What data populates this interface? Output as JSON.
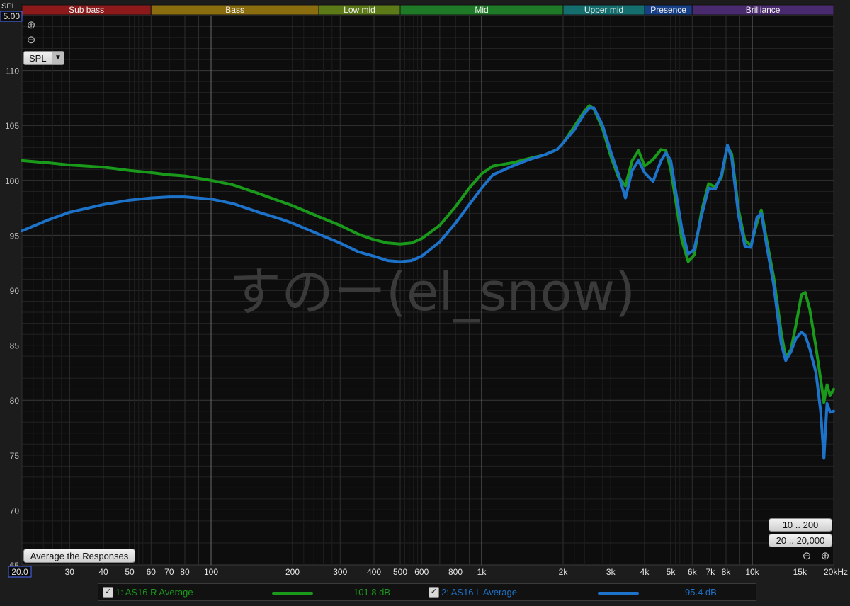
{
  "colors": {
    "series1": "#1a9a1a",
    "series2": "#1d72c9",
    "background": "#0d0d0d"
  },
  "bands": [
    {
      "label": "Sub bass",
      "from": 20,
      "to": 60,
      "color": "#8c1a1a"
    },
    {
      "label": "Bass",
      "from": 60,
      "to": 250,
      "color": "#8a6d0e"
    },
    {
      "label": "Low mid",
      "from": 250,
      "to": 500,
      "color": "#5d7a18"
    },
    {
      "label": "Mid",
      "from": 500,
      "to": 2000,
      "color": "#1e7a26"
    },
    {
      "label": "Upper mid",
      "from": 2000,
      "to": 4000,
      "color": "#156e6e"
    },
    {
      "label": "Presence",
      "from": 4000,
      "to": 6000,
      "color": "#173f85"
    },
    {
      "label": "Brilliance",
      "from": 6000,
      "to": 20000,
      "color": "#4a2a6e"
    }
  ],
  "controls": {
    "y_axis_label": "SPL",
    "y_top_value": "5.00",
    "x_left_value": "20.0",
    "spl_select": "SPL",
    "average_button": "Average the Responses",
    "range_button_1": "10 .. 200",
    "range_button_2": "20 .. 20,000",
    "zoom_in_icon": "⊕",
    "zoom_out_icon": "⊖"
  },
  "watermark": "すのー(el_snow)",
  "legend": {
    "items": [
      {
        "label": "1: AS16 R Average",
        "value": "101.8 dB",
        "color": "#1a9a1a"
      },
      {
        "label": "2: AS16 L Average",
        "value": "95.4 dB",
        "color": "#1d72c9"
      }
    ]
  },
  "chart_data": {
    "type": "line",
    "xlabel": "",
    "ylabel": "SPL",
    "x_scale": "log",
    "xlim": [
      20,
      20000
    ],
    "ylim": [
      65,
      115
    ],
    "grid": true,
    "y_ticks": [
      65,
      70,
      75,
      80,
      85,
      90,
      95,
      100,
      105,
      110
    ],
    "x_ticks": [
      {
        "v": 30,
        "label": "30"
      },
      {
        "v": 40,
        "label": "40"
      },
      {
        "v": 50,
        "label": "50"
      },
      {
        "v": 60,
        "label": "60"
      },
      {
        "v": 70,
        "label": "70"
      },
      {
        "v": 80,
        "label": "80"
      },
      {
        "v": 100,
        "label": "100"
      },
      {
        "v": 200,
        "label": "200"
      },
      {
        "v": 300,
        "label": "300"
      },
      {
        "v": 400,
        "label": "400"
      },
      {
        "v": 500,
        "label": "500"
      },
      {
        "v": 600,
        "label": "600"
      },
      {
        "v": 800,
        "label": "800"
      },
      {
        "v": 1000,
        "label": "1k"
      },
      {
        "v": 2000,
        "label": "2k"
      },
      {
        "v": 3000,
        "label": "3k"
      },
      {
        "v": 4000,
        "label": "4k"
      },
      {
        "v": 5000,
        "label": "5k"
      },
      {
        "v": 6000,
        "label": "6k"
      },
      {
        "v": 7000,
        "label": "7k"
      },
      {
        "v": 8000,
        "label": "8k"
      },
      {
        "v": 10000,
        "label": "10k"
      },
      {
        "v": 15000,
        "label": "15k"
      },
      {
        "v": 20000,
        "label": "20kHz"
      }
    ],
    "series": [
      {
        "name": "1: AS16 R Average",
        "points": [
          [
            20,
            101.8
          ],
          [
            25,
            101.6
          ],
          [
            30,
            101.4
          ],
          [
            40,
            101.2
          ],
          [
            50,
            100.9
          ],
          [
            60,
            100.7
          ],
          [
            70,
            100.5
          ],
          [
            80,
            100.4
          ],
          [
            100,
            100.0
          ],
          [
            120,
            99.6
          ],
          [
            150,
            98.8
          ],
          [
            180,
            98.1
          ],
          [
            200,
            97.7
          ],
          [
            250,
            96.7
          ],
          [
            300,
            95.9
          ],
          [
            350,
            95.1
          ],
          [
            400,
            94.6
          ],
          [
            450,
            94.3
          ],
          [
            500,
            94.2
          ],
          [
            550,
            94.3
          ],
          [
            600,
            94.7
          ],
          [
            700,
            95.9
          ],
          [
            800,
            97.6
          ],
          [
            900,
            99.3
          ],
          [
            1000,
            100.6
          ],
          [
            1100,
            101.3
          ],
          [
            1300,
            101.6
          ],
          [
            1500,
            102.0
          ],
          [
            1700,
            102.3
          ],
          [
            1900,
            102.8
          ],
          [
            2000,
            103.4
          ],
          [
            2200,
            104.9
          ],
          [
            2400,
            106.3
          ],
          [
            2500,
            106.8
          ],
          [
            2600,
            106.5
          ],
          [
            2800,
            104.7
          ],
          [
            3000,
            102.2
          ],
          [
            3200,
            100.3
          ],
          [
            3400,
            99.5
          ],
          [
            3600,
            101.8
          ],
          [
            3800,
            102.7
          ],
          [
            4000,
            101.3
          ],
          [
            4300,
            101.9
          ],
          [
            4600,
            102.8
          ],
          [
            4800,
            102.7
          ],
          [
            5000,
            101.0
          ],
          [
            5500,
            94.5
          ],
          [
            5800,
            92.6
          ],
          [
            6100,
            93.2
          ],
          [
            6500,
            97.2
          ],
          [
            6900,
            99.7
          ],
          [
            7300,
            99.4
          ],
          [
            7700,
            100.3
          ],
          [
            8100,
            103.1
          ],
          [
            8400,
            102.4
          ],
          [
            8900,
            97.3
          ],
          [
            9400,
            94.5
          ],
          [
            9900,
            94.1
          ],
          [
            10400,
            96.1
          ],
          [
            10800,
            97.3
          ],
          [
            11300,
            94.6
          ],
          [
            12000,
            91.2
          ],
          [
            12800,
            86.1
          ],
          [
            13300,
            83.9
          ],
          [
            13900,
            84.6
          ],
          [
            14500,
            86.8
          ],
          [
            15200,
            89.6
          ],
          [
            15700,
            89.8
          ],
          [
            16300,
            88.3
          ],
          [
            17200,
            84.8
          ],
          [
            17900,
            81.9
          ],
          [
            18400,
            79.8
          ],
          [
            18900,
            81.4
          ],
          [
            19400,
            80.4
          ],
          [
            20000,
            81.0
          ]
        ]
      },
      {
        "name": "2: AS16 L Average",
        "points": [
          [
            20,
            95.4
          ],
          [
            25,
            96.4
          ],
          [
            30,
            97.1
          ],
          [
            40,
            97.8
          ],
          [
            50,
            98.2
          ],
          [
            60,
            98.4
          ],
          [
            70,
            98.5
          ],
          [
            80,
            98.5
          ],
          [
            100,
            98.3
          ],
          [
            120,
            97.9
          ],
          [
            150,
            97.1
          ],
          [
            180,
            96.5
          ],
          [
            200,
            96.1
          ],
          [
            250,
            95.1
          ],
          [
            300,
            94.3
          ],
          [
            350,
            93.5
          ],
          [
            400,
            93.1
          ],
          [
            450,
            92.7
          ],
          [
            500,
            92.6
          ],
          [
            550,
            92.7
          ],
          [
            600,
            93.1
          ],
          [
            700,
            94.4
          ],
          [
            800,
            96.1
          ],
          [
            900,
            97.8
          ],
          [
            1000,
            99.3
          ],
          [
            1100,
            100.5
          ],
          [
            1300,
            101.3
          ],
          [
            1500,
            101.9
          ],
          [
            1700,
            102.3
          ],
          [
            1900,
            102.8
          ],
          [
            2000,
            103.4
          ],
          [
            2200,
            104.6
          ],
          [
            2400,
            106.1
          ],
          [
            2500,
            106.6
          ],
          [
            2600,
            106.6
          ],
          [
            2800,
            105.0
          ],
          [
            3000,
            102.6
          ],
          [
            3200,
            100.6
          ],
          [
            3400,
            98.4
          ],
          [
            3600,
            100.9
          ],
          [
            3800,
            101.8
          ],
          [
            4000,
            100.7
          ],
          [
            4300,
            99.9
          ],
          [
            4600,
            101.8
          ],
          [
            4800,
            102.5
          ],
          [
            5000,
            101.8
          ],
          [
            5500,
            95.5
          ],
          [
            5800,
            93.3
          ],
          [
            6100,
            93.7
          ],
          [
            6500,
            96.8
          ],
          [
            6900,
            99.3
          ],
          [
            7300,
            99.2
          ],
          [
            7700,
            100.5
          ],
          [
            8100,
            103.2
          ],
          [
            8400,
            102.0
          ],
          [
            8900,
            96.8
          ],
          [
            9400,
            94.0
          ],
          [
            9900,
            93.9
          ],
          [
            10400,
            96.6
          ],
          [
            10800,
            97.0
          ],
          [
            11300,
            94.1
          ],
          [
            12000,
            90.5
          ],
          [
            12800,
            85.1
          ],
          [
            13300,
            83.6
          ],
          [
            13900,
            84.4
          ],
          [
            14500,
            85.6
          ],
          [
            15200,
            86.2
          ],
          [
            15700,
            85.9
          ],
          [
            16300,
            84.7
          ],
          [
            17200,
            82.5
          ],
          [
            17900,
            79.0
          ],
          [
            18400,
            74.7
          ],
          [
            18900,
            79.7
          ],
          [
            19400,
            78.9
          ],
          [
            20000,
            79.0
          ]
        ]
      }
    ]
  }
}
